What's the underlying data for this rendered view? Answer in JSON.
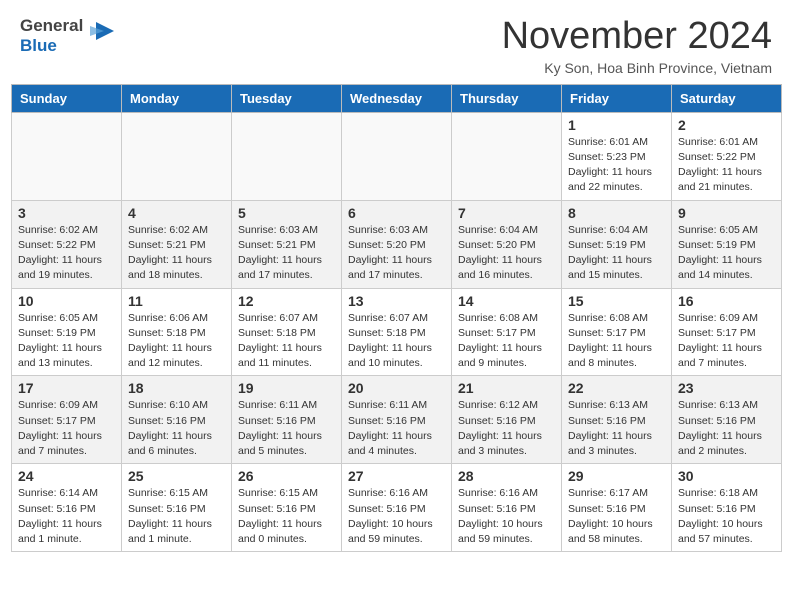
{
  "header": {
    "logo_general": "General",
    "logo_blue": "Blue",
    "month_title": "November 2024",
    "subtitle": "Ky Son, Hoa Binh Province, Vietnam"
  },
  "weekdays": [
    "Sunday",
    "Monday",
    "Tuesday",
    "Wednesday",
    "Thursday",
    "Friday",
    "Saturday"
  ],
  "weeks": [
    [
      {
        "day": "",
        "info": "",
        "empty": true
      },
      {
        "day": "",
        "info": "",
        "empty": true
      },
      {
        "day": "",
        "info": "",
        "empty": true
      },
      {
        "day": "",
        "info": "",
        "empty": true
      },
      {
        "day": "",
        "info": "",
        "empty": true
      },
      {
        "day": "1",
        "info": "Sunrise: 6:01 AM\nSunset: 5:23 PM\nDaylight: 11 hours and 22 minutes."
      },
      {
        "day": "2",
        "info": "Sunrise: 6:01 AM\nSunset: 5:22 PM\nDaylight: 11 hours and 21 minutes."
      }
    ],
    [
      {
        "day": "3",
        "info": "Sunrise: 6:02 AM\nSunset: 5:22 PM\nDaylight: 11 hours and 19 minutes."
      },
      {
        "day": "4",
        "info": "Sunrise: 6:02 AM\nSunset: 5:21 PM\nDaylight: 11 hours and 18 minutes."
      },
      {
        "day": "5",
        "info": "Sunrise: 6:03 AM\nSunset: 5:21 PM\nDaylight: 11 hours and 17 minutes."
      },
      {
        "day": "6",
        "info": "Sunrise: 6:03 AM\nSunset: 5:20 PM\nDaylight: 11 hours and 17 minutes."
      },
      {
        "day": "7",
        "info": "Sunrise: 6:04 AM\nSunset: 5:20 PM\nDaylight: 11 hours and 16 minutes."
      },
      {
        "day": "8",
        "info": "Sunrise: 6:04 AM\nSunset: 5:19 PM\nDaylight: 11 hours and 15 minutes."
      },
      {
        "day": "9",
        "info": "Sunrise: 6:05 AM\nSunset: 5:19 PM\nDaylight: 11 hours and 14 minutes."
      }
    ],
    [
      {
        "day": "10",
        "info": "Sunrise: 6:05 AM\nSunset: 5:19 PM\nDaylight: 11 hours and 13 minutes."
      },
      {
        "day": "11",
        "info": "Sunrise: 6:06 AM\nSunset: 5:18 PM\nDaylight: 11 hours and 12 minutes."
      },
      {
        "day": "12",
        "info": "Sunrise: 6:07 AM\nSunset: 5:18 PM\nDaylight: 11 hours and 11 minutes."
      },
      {
        "day": "13",
        "info": "Sunrise: 6:07 AM\nSunset: 5:18 PM\nDaylight: 11 hours and 10 minutes."
      },
      {
        "day": "14",
        "info": "Sunrise: 6:08 AM\nSunset: 5:17 PM\nDaylight: 11 hours and 9 minutes."
      },
      {
        "day": "15",
        "info": "Sunrise: 6:08 AM\nSunset: 5:17 PM\nDaylight: 11 hours and 8 minutes."
      },
      {
        "day": "16",
        "info": "Sunrise: 6:09 AM\nSunset: 5:17 PM\nDaylight: 11 hours and 7 minutes."
      }
    ],
    [
      {
        "day": "17",
        "info": "Sunrise: 6:09 AM\nSunset: 5:17 PM\nDaylight: 11 hours and 7 minutes."
      },
      {
        "day": "18",
        "info": "Sunrise: 6:10 AM\nSunset: 5:16 PM\nDaylight: 11 hours and 6 minutes."
      },
      {
        "day": "19",
        "info": "Sunrise: 6:11 AM\nSunset: 5:16 PM\nDaylight: 11 hours and 5 minutes."
      },
      {
        "day": "20",
        "info": "Sunrise: 6:11 AM\nSunset: 5:16 PM\nDaylight: 11 hours and 4 minutes."
      },
      {
        "day": "21",
        "info": "Sunrise: 6:12 AM\nSunset: 5:16 PM\nDaylight: 11 hours and 3 minutes."
      },
      {
        "day": "22",
        "info": "Sunrise: 6:13 AM\nSunset: 5:16 PM\nDaylight: 11 hours and 3 minutes."
      },
      {
        "day": "23",
        "info": "Sunrise: 6:13 AM\nSunset: 5:16 PM\nDaylight: 11 hours and 2 minutes."
      }
    ],
    [
      {
        "day": "24",
        "info": "Sunrise: 6:14 AM\nSunset: 5:16 PM\nDaylight: 11 hours and 1 minute."
      },
      {
        "day": "25",
        "info": "Sunrise: 6:15 AM\nSunset: 5:16 PM\nDaylight: 11 hours and 1 minute."
      },
      {
        "day": "26",
        "info": "Sunrise: 6:15 AM\nSunset: 5:16 PM\nDaylight: 11 hours and 0 minutes."
      },
      {
        "day": "27",
        "info": "Sunrise: 6:16 AM\nSunset: 5:16 PM\nDaylight: 10 hours and 59 minutes."
      },
      {
        "day": "28",
        "info": "Sunrise: 6:16 AM\nSunset: 5:16 PM\nDaylight: 10 hours and 59 minutes."
      },
      {
        "day": "29",
        "info": "Sunrise: 6:17 AM\nSunset: 5:16 PM\nDaylight: 10 hours and 58 minutes."
      },
      {
        "day": "30",
        "info": "Sunrise: 6:18 AM\nSunset: 5:16 PM\nDaylight: 10 hours and 57 minutes."
      }
    ]
  ]
}
